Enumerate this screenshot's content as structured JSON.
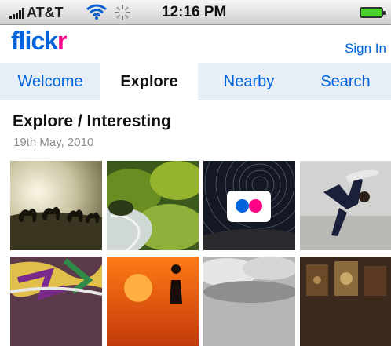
{
  "status_bar": {
    "carrier": "AT&T",
    "time": "12:16 PM",
    "icons": [
      "signal-bars-icon",
      "wifi-icon",
      "activity-spinner-icon",
      "battery-icon"
    ]
  },
  "header": {
    "logo": {
      "text_main": "flick",
      "text_accent": "r"
    },
    "sign_in": "Sign In",
    "brand_blue": "#0063dc",
    "brand_pink": "#ff0084"
  },
  "tabs": [
    {
      "label": "Welcome",
      "active": false
    },
    {
      "label": "Explore",
      "active": true
    },
    {
      "label": "Nearby",
      "active": false
    },
    {
      "label": "Search",
      "active": false
    }
  ],
  "page": {
    "title": "Explore / Interesting",
    "date": "19th May, 2010"
  },
  "photos": [
    {
      "name": "camels-desert-photo"
    },
    {
      "name": "waterfall-moss-photo"
    },
    {
      "name": "star-trails-photo",
      "badge": "flickr-logo-icon"
    },
    {
      "name": "dancer-jump-photo"
    },
    {
      "name": "graffiti-photo"
    },
    {
      "name": "sunset-silhouette-photo"
    },
    {
      "name": "cloudy-sky-photo"
    },
    {
      "name": "vintage-interior-photo"
    }
  ]
}
